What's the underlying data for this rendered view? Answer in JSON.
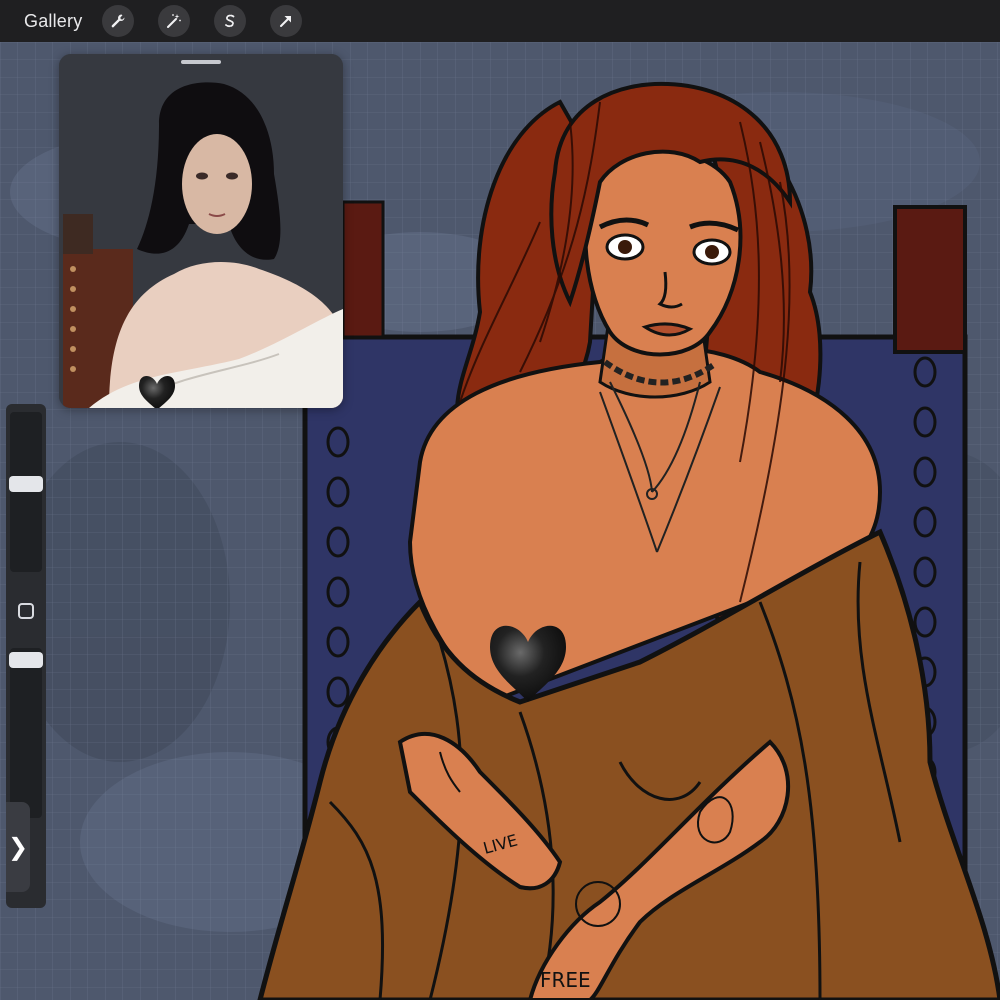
{
  "toolbar": {
    "gallery_label": "Gallery",
    "tools": [
      {
        "name": "actions",
        "icon": "wrench-icon"
      },
      {
        "name": "adjustments",
        "icon": "magic-wand-icon"
      },
      {
        "name": "selection",
        "icon": "selection-s-icon"
      },
      {
        "name": "transform",
        "icon": "arrow-icon"
      }
    ]
  },
  "sidebar": {
    "brush_size_label": "",
    "opacity_label": ""
  },
  "collapse_tab": {
    "glyph": "❯"
  },
  "colors": {
    "toolbar_bg": "#1f1f21",
    "canvas_bg": "#4f5a70",
    "skin": "#d98050",
    "hair": "#8a2a10",
    "dress": "#8a5020",
    "chair": "#33386a",
    "heart": "#1b1b1b"
  }
}
